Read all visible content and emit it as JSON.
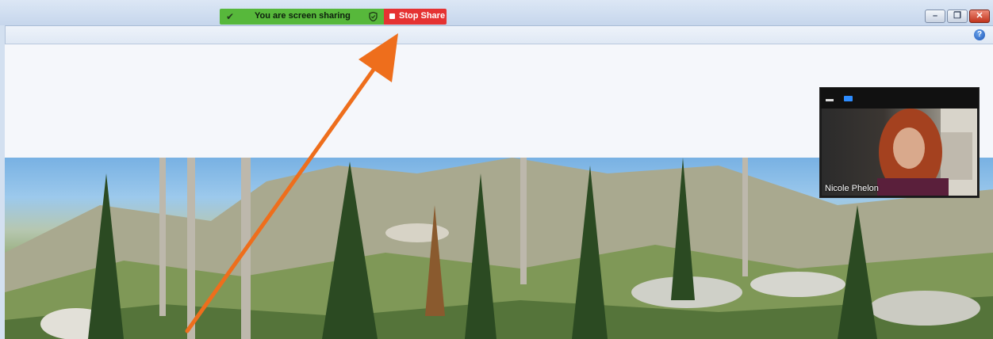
{
  "share_bar": {
    "status_text": "You are screen sharing",
    "stop_label": "Stop Share"
  },
  "video": {
    "participant_name": "Nicole Phelon"
  },
  "help": {
    "glyph": "?"
  },
  "window_controls": {
    "minimize": "–",
    "restore": "❐",
    "close": "✕"
  },
  "colors": {
    "share_green": "#57b83b",
    "stop_red": "#e53232",
    "arrow_orange": "#ee6e1c",
    "video_accent": "#2d8cff"
  }
}
